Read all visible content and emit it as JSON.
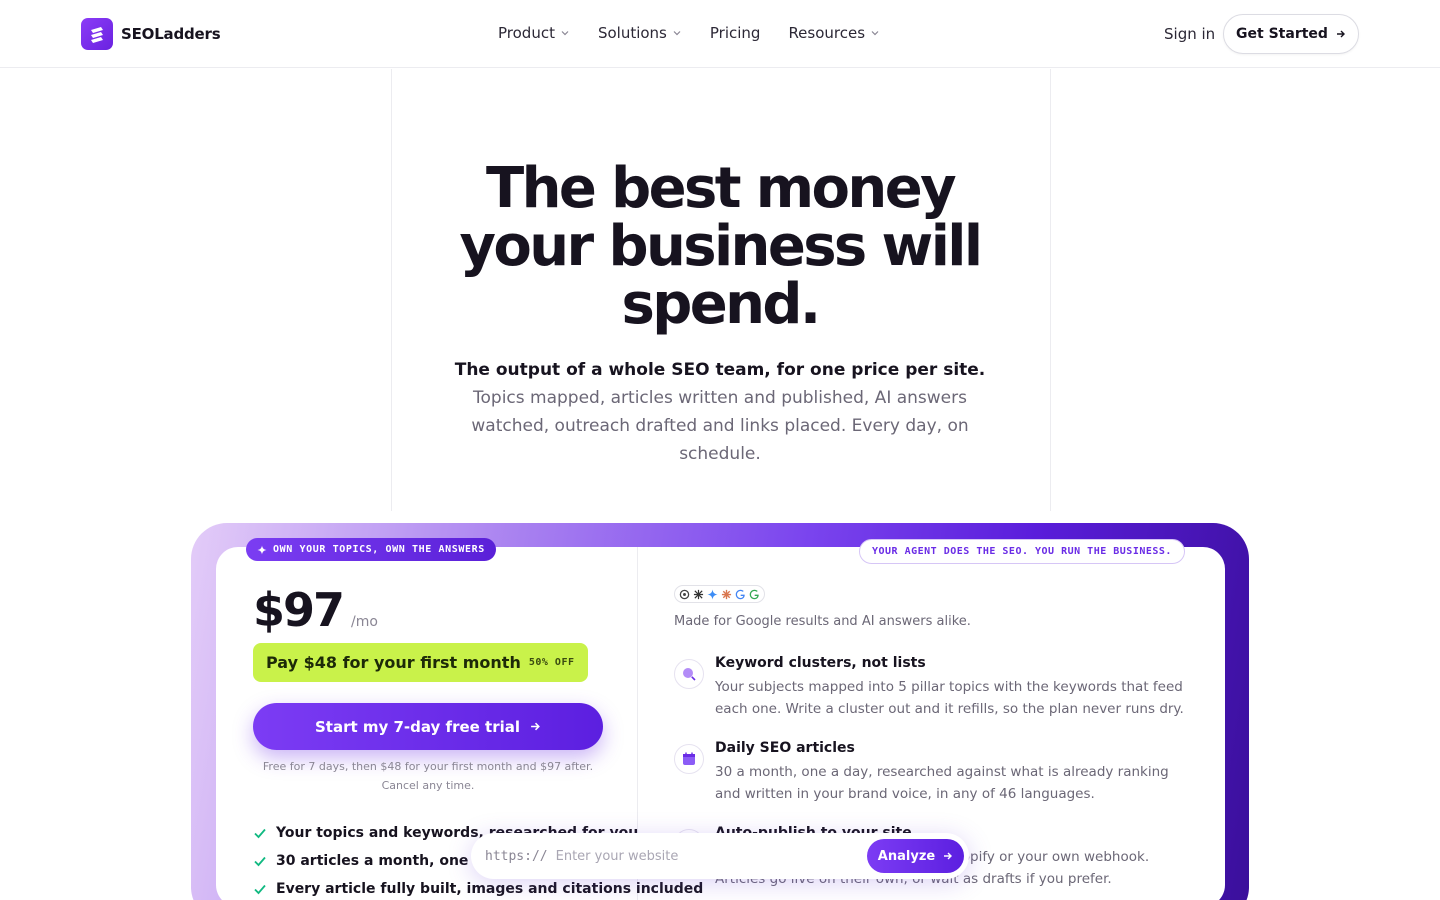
{
  "nav": {
    "brand": "SEOLadders",
    "links": [
      {
        "label": "Product",
        "dropdown": true
      },
      {
        "label": "Solutions",
        "dropdown": true
      },
      {
        "label": "Pricing",
        "dropdown": false
      },
      {
        "label": "Resources",
        "dropdown": true
      }
    ],
    "signin": "Sign in",
    "get_started": "Get Started"
  },
  "hero": {
    "title": "The best money your business will spend.",
    "sub_strong": "The output of a whole SEO team, for one price per site.",
    "sub_rest": " Topics mapped, articles written and published, AI answers watched, outreach drafted and links placed. Every day, on schedule."
  },
  "card": {
    "badge_left": "OWN YOUR TOPICS, OWN THE ANSWERS",
    "badge_right": "YOUR AGENT DOES THE SEO. YOU RUN THE BUSINESS.",
    "price": "$97",
    "price_period": "/mo",
    "offer": "Pay $48 for your first month",
    "offer_tag": "50% OFF",
    "cta": "Start my 7-day free trial",
    "trial_note": "Free for 7 days, then $48 for your first month and $97 after. Cancel any time.",
    "checklist": [
      "Your topics and keywords, researched for you",
      "30 articles a month, one a day",
      "Every article fully built, images and citations included"
    ],
    "made_for": "Made for Google results and AI answers alike.",
    "features": [
      {
        "icon": "search-icon",
        "title": "Keyword clusters, not lists",
        "desc": "Your subjects mapped into 5 pillar topics with the keywords that feed each one. Write a cluster out and it refills, so the plan never runs dry."
      },
      {
        "icon": "calendar-icon",
        "title": "Daily SEO articles",
        "desc": "30 a month, one a day, researched against what is already ranking and written in your brand voice, in any of 46 languages."
      },
      {
        "icon": "publish-icon",
        "title": "Auto-publish to your site",
        "desc": "Connects to WordPress, Webflow, Shopify or your own webhook. Articles go live on their own, or wait as drafts if you prefer."
      }
    ]
  },
  "urlbar": {
    "prefix": "https://",
    "placeholder": "Enter your website",
    "button": "Analyze"
  },
  "colors": {
    "accent": "#6a2ce6",
    "offer_bg": "#c9f24a",
    "check": "#10b981"
  }
}
